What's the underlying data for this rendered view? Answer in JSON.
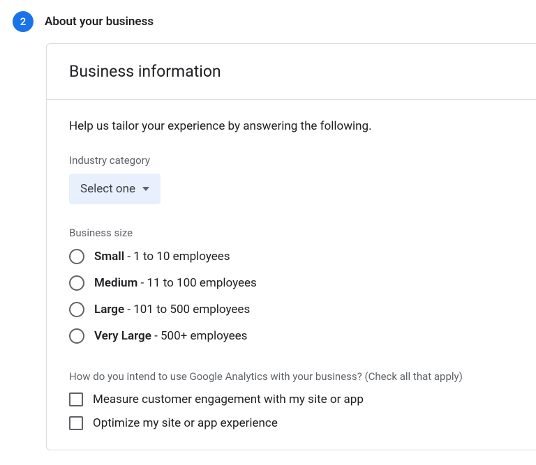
{
  "step": {
    "number": "2",
    "title": "About your business"
  },
  "card": {
    "title": "Business information",
    "intro": "Help us tailor your experience by answering the following."
  },
  "industry": {
    "label": "Industry category",
    "selected": "Select one"
  },
  "business_size": {
    "label": "Business size",
    "options": [
      {
        "bold": "Small",
        "rest": " - 1 to 10 employees"
      },
      {
        "bold": "Medium",
        "rest": " - 11 to 100 employees"
      },
      {
        "bold": "Large",
        "rest": " - 101 to 500 employees"
      },
      {
        "bold": "Very Large",
        "rest": " - 500+ employees"
      }
    ]
  },
  "usage": {
    "label": "How do you intend to use Google Analytics with your business? (Check all that apply)",
    "options": [
      "Measure customer engagement with my site or app",
      "Optimize my site or app experience"
    ]
  }
}
